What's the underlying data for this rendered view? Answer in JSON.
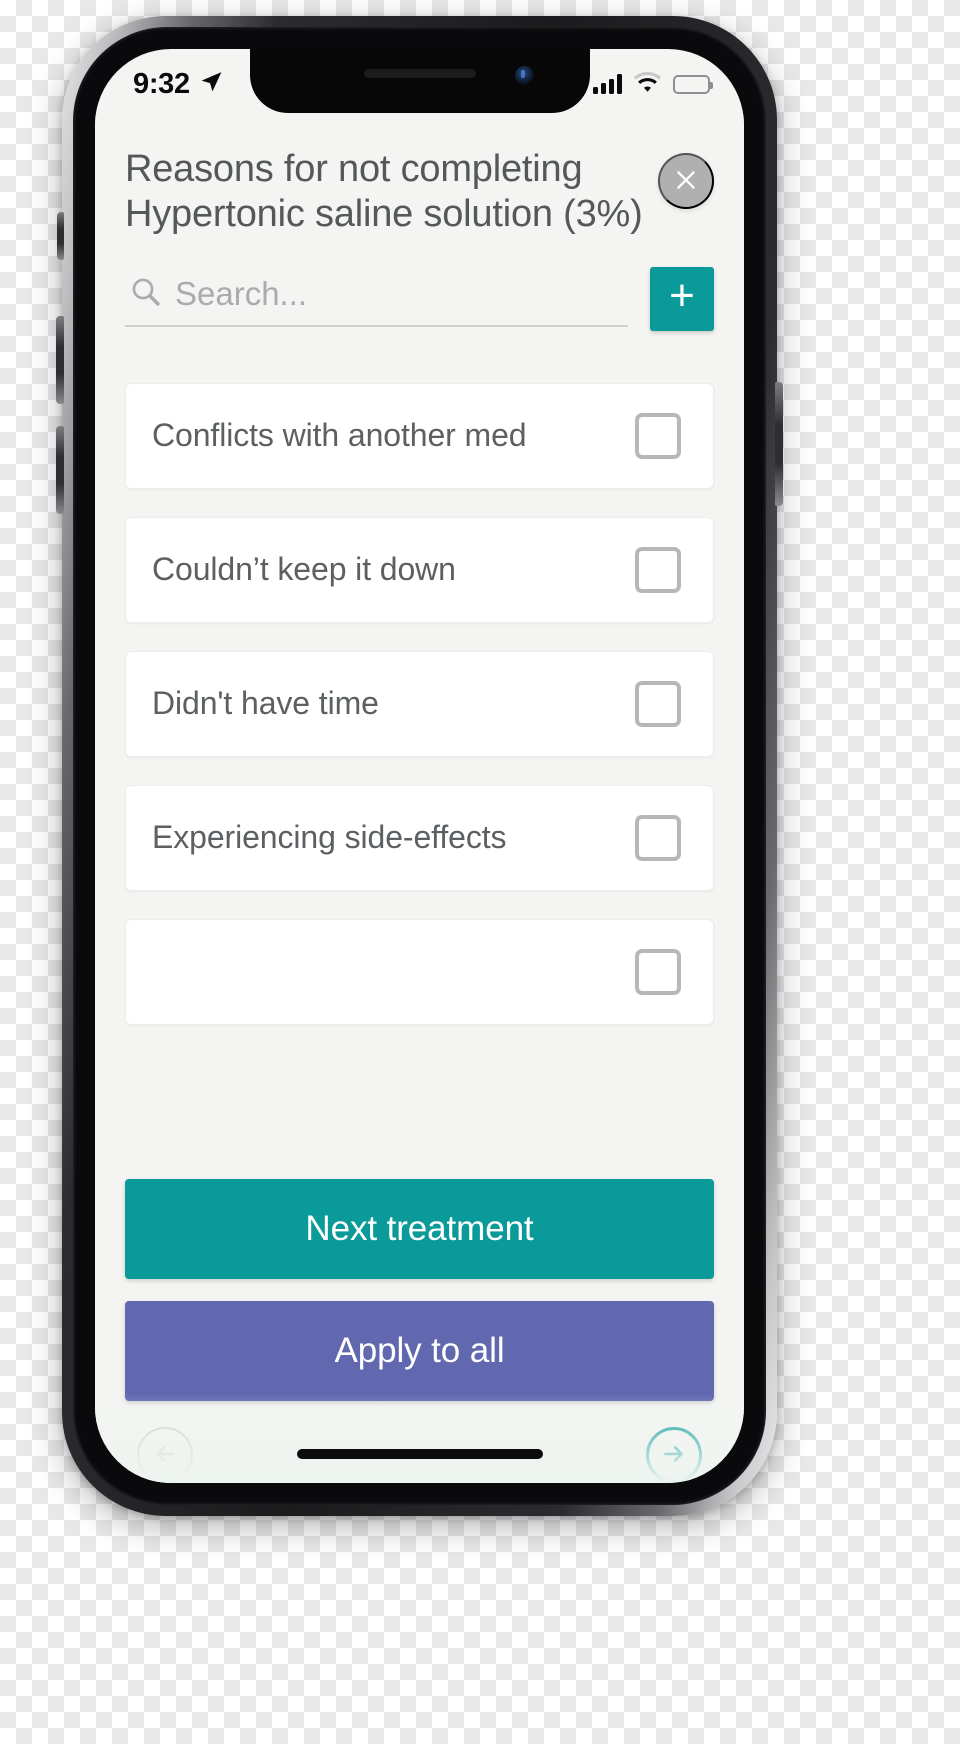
{
  "status_bar": {
    "time": "9:32",
    "location_icon": "location-arrow-icon",
    "signal_icon": "cellular-signal-icon",
    "wifi_icon": "wifi-icon",
    "battery_icon": "battery-icon"
  },
  "header": {
    "title": "Reasons for not completing Hypertonic saline solution (3%)",
    "close_icon": "close-icon"
  },
  "search": {
    "placeholder": "Search...",
    "value": "",
    "icon": "search-icon",
    "add_label": "+"
  },
  "reasons": [
    {
      "label": "Conflicts with another med",
      "checked": false
    },
    {
      "label": "Couldn’t keep it down",
      "checked": false
    },
    {
      "label": "Didn't have time",
      "checked": false
    },
    {
      "label": "Experiencing side-effects",
      "checked": false
    },
    {
      "label": "",
      "checked": false
    }
  ],
  "actions": {
    "next_treatment_label": "Next treatment",
    "apply_to_all_label": "Apply to all"
  },
  "bottom_nav": {
    "back_icon": "arrow-left-circle-icon",
    "forward_icon": "arrow-right-circle-icon"
  },
  "colors": {
    "teal": "#0b9a9a",
    "purple": "#6168b0",
    "screen_background": "#f4f5f2",
    "card_background": "#ffffff",
    "text": "#54585a",
    "muted": "#b0b0b0"
  }
}
